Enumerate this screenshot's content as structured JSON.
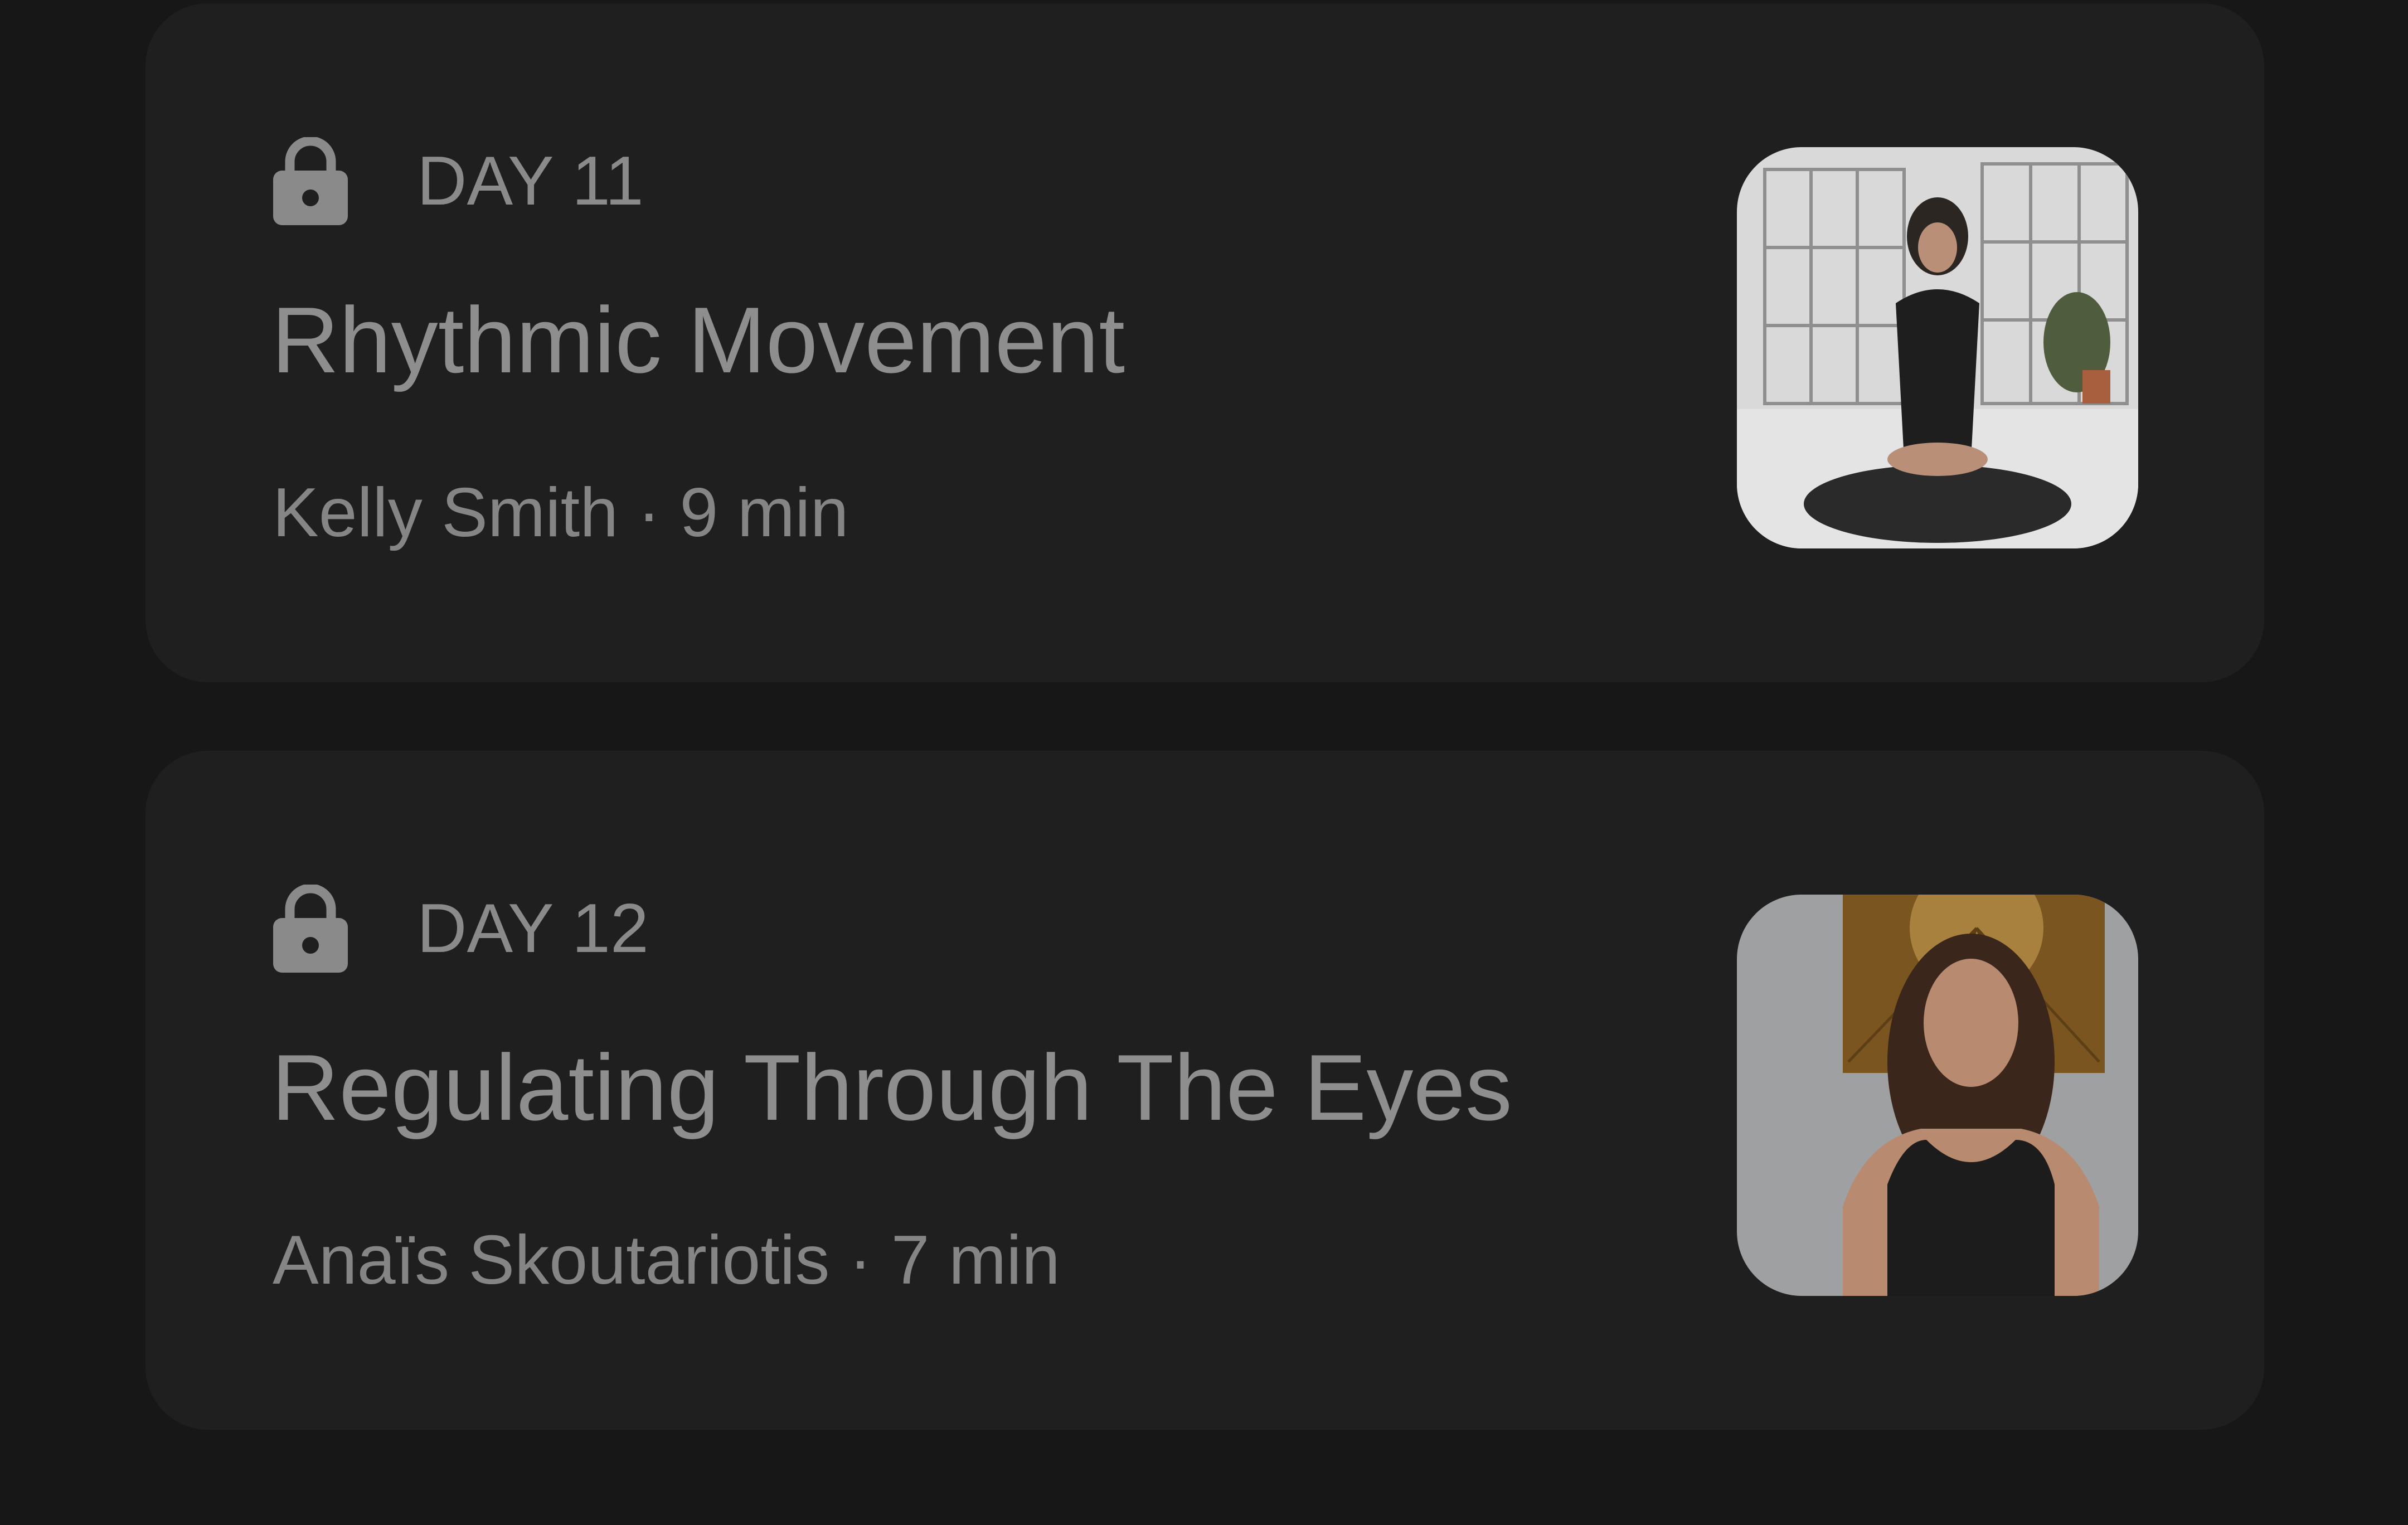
{
  "sessions": [
    {
      "day_label": "DAY 11",
      "title": "Rhythmic Movement",
      "meta": "Kelly Smith · 9 min",
      "locked": true,
      "lock_icon": "lock-icon",
      "thumbnail": "instructor-photo-meditating"
    },
    {
      "day_label": "DAY 12",
      "title": "Regulating Through The Eyes",
      "meta": "Anaïs Skoutariotis · 7 min",
      "locked": true,
      "lock_icon": "lock-icon",
      "thumbnail": "instructor-photo-portrait"
    }
  ],
  "colors": {
    "background": "#171717",
    "card": "#1f1f1f",
    "text": "#8e8e8e"
  }
}
